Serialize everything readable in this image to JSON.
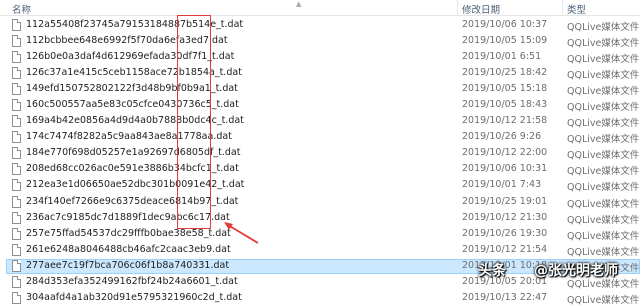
{
  "columns": {
    "name": "名称",
    "date": "修改日期",
    "type": "类型"
  },
  "files": [
    {
      "name": "112a55408f23745a79153184887b514e_t.dat",
      "date": "2019/10/06 10:37",
      "type": "QQLive媒体文件(..."
    },
    {
      "name": "112bcbbee648e6992f5f70da6efa3ed7.dat",
      "date": "2019/10/05 15:09",
      "type": "QQLive媒体文件(..."
    },
    {
      "name": "126b0e0a3daf4d612969efada30df7f1_t.dat",
      "date": "2019/10/01 6:51",
      "type": "QQLive媒体文件(..."
    },
    {
      "name": "126c37a1e415c5ceb1158ace72b1854a_t.dat",
      "date": "2019/10/25 18:42",
      "type": "QQLive媒体文件(..."
    },
    {
      "name": "149efd150752802122f3d48b9bf0b9a1_t.dat",
      "date": "2019/10/05 15:18",
      "type": "QQLive媒体文件(..."
    },
    {
      "name": "160c500557aa5e83c05cfce0430736c5_t.dat",
      "date": "2019/10/05 18:43",
      "type": "QQLive媒体文件(..."
    },
    {
      "name": "169a4b42e0856a4d9d4a0b7888b0dc4c_t.dat",
      "date": "2019/10/12 21:58",
      "type": "QQLive媒体文件(..."
    },
    {
      "name": "174c7474f8282a5c9aa843ae8a1778aa.dat",
      "date": "2019/10/26 9:26",
      "type": "QQLive媒体文件(..."
    },
    {
      "name": "184e770f698d05257e1a92697d6805df_t.dat",
      "date": "2019/10/12 22:00",
      "type": "QQLive媒体文件(..."
    },
    {
      "name": "208ed68cc026ac0e591e3886b34bcfc1_t.dat",
      "date": "2019/10/06 10:31",
      "type": "QQLive媒体文件(..."
    },
    {
      "name": "212ea3e1d06650ae52dbc301b0091e42_t.dat",
      "date": "2019/10/01 7:43",
      "type": "QQLive媒体文件(..."
    },
    {
      "name": "234f140ef7266e9c6375deace6814b97_t.dat",
      "date": "2019/10/25 19:01",
      "type": "QQLive媒体文件(..."
    },
    {
      "name": "236ac7c9185dc7d1889f1dec9abc6c17.dat",
      "date": "2019/10/12 21:30",
      "type": "QQLive媒体文件(..."
    },
    {
      "name": "257e75ffad54537dc29fffb0bae38e58_t.dat",
      "date": "2019/10/26 19:30",
      "type": "QQLive媒体文件(..."
    },
    {
      "name": "261e6248a8046488cb46afc2caac3eb9.dat",
      "date": "2019/10/12 21:54",
      "type": "QQLive媒体文件(..."
    },
    {
      "name": "277aee7c19f7bca706c06f1b8a740331.dat",
      "date": "2019/10/01 10:18",
      "type": "QQLive媒体文件(...",
      "selected": true
    },
    {
      "name": "284d353efa352499162fbf24b24a6601_t.dat",
      "date": "2019/10/05 20:01",
      "type": "QQLive媒体文件(..."
    },
    {
      "name": "304aafd4a1ab320d91e5795321960c2d_t.dat",
      "date": "2019/10/13 22:47",
      "type": "QQLive媒体文件(..."
    }
  ],
  "watermark": {
    "logo": "头条",
    "text": "@张光明老师"
  },
  "colors": {
    "annotation": "#e23b3b",
    "selection": "#cce8ff",
    "selection_border": "#99d1ff"
  }
}
